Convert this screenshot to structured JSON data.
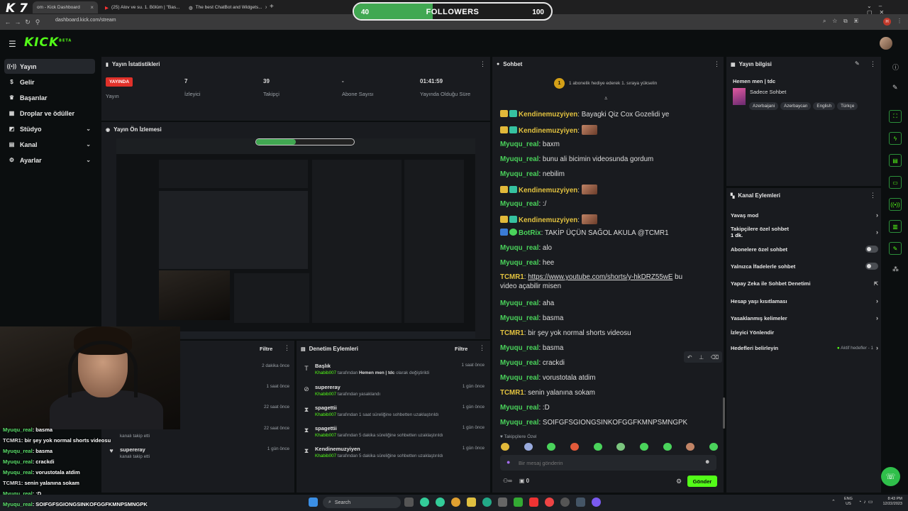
{
  "browser": {
    "tabs": [
      {
        "label": "om - Kick Dashboard",
        "active": true
      },
      {
        "label": "(25) Alov ve su. 1. Bölüm | \"Bas...",
        "active": false
      },
      {
        "label": "The best ChatBot and Widgets...",
        "active": false
      }
    ],
    "url": "dashboard.kick.com/stream",
    "overlay_logo": "K 7"
  },
  "followers_bar": {
    "left": "40",
    "label": "FOLLOWERS",
    "right": "100",
    "progress": 0.4
  },
  "header": {
    "logo": "KICK",
    "logo_sup": "BETA"
  },
  "sidebar": {
    "items": [
      {
        "label": "Yayın",
        "icon": "broadcast-icon"
      },
      {
        "label": "Gelir",
        "icon": "dollar-icon"
      },
      {
        "label": "Başarılar",
        "icon": "trophy-icon"
      },
      {
        "label": "Droplar ve ödüller",
        "icon": "gift-icon"
      },
      {
        "label": "Stüdyo",
        "icon": "studio-icon"
      },
      {
        "label": "Kanal",
        "icon": "channel-icon"
      },
      {
        "label": "Ayarlar",
        "icon": "gear-icon"
      }
    ]
  },
  "stats": {
    "title": "Yayın İstatistikleri",
    "live_badge": "YAYINDA",
    "live_label": "Yayın",
    "items": [
      {
        "value": "7",
        "label": "İzleyici"
      },
      {
        "value": "39",
        "label": "Takipçi"
      },
      {
        "value": "-",
        "label": "Abone Sayısı"
      },
      {
        "value": "01:41:59",
        "label": "Yayında Olduğu Süre"
      }
    ]
  },
  "preview": {
    "title": "Yayın Ön İzlemesi"
  },
  "activity": {
    "filter_label": "Filtre",
    "rows": [
      {
        "title": "",
        "sub": "",
        "time": "2 dakika önce"
      },
      {
        "title": "",
        "sub": "",
        "time": "1 saat önce"
      },
      {
        "title": "",
        "sub": "",
        "time": "22 saat önce"
      },
      {
        "title": "",
        "sub": "kanalı takip etti",
        "time": "22 saat önce"
      },
      {
        "title": "supereray",
        "sub": "kanalı takip etti",
        "time": "1 gün önce"
      }
    ]
  },
  "moderation": {
    "title": "Denetim Eylemleri",
    "filter_label": "Filtre",
    "rows": [
      {
        "title": "Başlık",
        "actor": "Khabib007",
        "text": "tarafından",
        "bold": "Hemen men | tdc",
        "rest": "olarak değiştirildi",
        "time": "1 saat önce",
        "icon": "text-icon"
      },
      {
        "title": "supereray",
        "actor": "Khabib007",
        "text": "tarafından yasaklandı",
        "bold": "",
        "rest": "",
        "time": "1 gün önce",
        "icon": "ban-icon"
      },
      {
        "title": "spagettii",
        "actor": "Khabib007",
        "text": "tarafından 1 saat süreliğine sohbetten uzaklaştırıldı",
        "bold": "",
        "rest": "",
        "time": "1 gün önce",
        "icon": "hourglass-icon"
      },
      {
        "title": "spagettii",
        "actor": "Khabib007",
        "text": "tarafından 5 dakika süreliğine sohbetten uzaklaştırıldı",
        "bold": "",
        "rest": "",
        "time": "1 gün önce",
        "icon": "hourglass-icon"
      },
      {
        "title": "Kendinemuzyiyen",
        "actor": "Khabib007",
        "text": "tarafından 5 dakika süreliğine sohbetten uzaklaştırıldı",
        "bold": "",
        "rest": "",
        "time": "1 gün önce",
        "icon": "hourglass-icon"
      }
    ]
  },
  "chat": {
    "title": "Sohbet",
    "gift_badge": "1",
    "gift_text": "1 abonelik hediye ederek 1. sıraya yükselin",
    "messages": [
      {
        "user": "Kendinemuzyiyen",
        "color": "uy",
        "badges": [
          "bcrown",
          "bgift"
        ],
        "text": "Bayagki Qiz Cox Gozelidi ye",
        "emote": false
      },
      {
        "user": "Kendinemuzyiyen",
        "color": "uy",
        "badges": [
          "bcrown",
          "bgift"
        ],
        "text": "",
        "emote": true
      },
      {
        "user": "Myuqu_real",
        "color": "ug",
        "badges": [],
        "text": "baxm",
        "emote": false
      },
      {
        "user": "Myuqu_real",
        "color": "ug",
        "badges": [],
        "text": "bunu ali bicimin videosunda gordum",
        "emote": false
      },
      {
        "user": "Myuqu_real",
        "color": "ug",
        "badges": [],
        "text": "nebilim",
        "emote": false
      },
      {
        "user": "Kendinemuzyiyen",
        "color": "uy",
        "badges": [
          "bcrown",
          "bgift"
        ],
        "text": "",
        "emote": true
      },
      {
        "user": "Myuqu_real",
        "color": "ug",
        "badges": [],
        "text": ":/",
        "emote": false
      },
      {
        "user": "Kendinemuzyiyen",
        "color": "uy",
        "badges": [
          "bcrown",
          "bgift"
        ],
        "text": "",
        "emote": true
      },
      {
        "user": "BotRix",
        "color": "ug",
        "badges": [
          "bbot",
          "bver"
        ],
        "text": "TAKİP ÜÇÜN SAĞOL AKULA @TCMR1",
        "emote": false
      },
      {
        "user": "Myuqu_real",
        "color": "ug",
        "badges": [],
        "text": "alo",
        "emote": false
      },
      {
        "user": "Myuqu_real",
        "color": "ug",
        "badges": [],
        "text": "hee",
        "emote": false
      }
    ],
    "link_msg": {
      "user": "TCMR1",
      "link": "https://www.youtube.com/shorts/y-hkDRZ55wE",
      "after": "bu",
      "line2": "video açabilir misen"
    },
    "messages2": [
      {
        "user": "Myuqu_real",
        "color": "ug",
        "text": "aha"
      },
      {
        "user": "Myuqu_real",
        "color": "ug",
        "text": "basma"
      },
      {
        "user": "TCMR1",
        "color": "uy",
        "text": "bir şey yok normal shorts videosu"
      },
      {
        "user": "Myuqu_real",
        "color": "ug",
        "text": "basma"
      },
      {
        "user": "Myuqu_real",
        "color": "ug",
        "text": "crackdi"
      },
      {
        "user": "Myuqu_real",
        "color": "ug",
        "text": "vorustotala atdim"
      },
      {
        "user": "TCMR1",
        "color": "uy",
        "text": "senin yalanına sokam"
      },
      {
        "user": "Myuqu_real",
        "color": "ug",
        "text": ":D"
      },
      {
        "user": "Myuqu_real",
        "color": "ug",
        "text": "SOIFGFSGIONGSINKOFGGFKMNPSMNGPK"
      }
    ],
    "followers_only": "Takipçilere Özel",
    "input_placeholder": "Bir mesaj gönderin",
    "footer_count": "0",
    "send_label": "Gönder"
  },
  "stream_info": {
    "title": "Yayın bilgisi",
    "stream_title": "Hemen men | tdc",
    "category": "Sadece Sohbet",
    "tags": [
      "Azerbaijani",
      "Azerbaycan",
      "English",
      "Türkçe"
    ]
  },
  "channel_actions": {
    "title": "Kanal Eylemleri",
    "items": [
      {
        "label": "Yavaş mod",
        "control": "chevron"
      },
      {
        "label": "Takipçilere özel sohbet",
        "sub": "1 dk.",
        "control": "chevron"
      },
      {
        "label": "Abonelere özel sohbet",
        "control": "toggle"
      },
      {
        "label": "Yalnızca İfadelerle sohbet",
        "control": "toggle"
      },
      {
        "label": "Yapay Zeka ile Sohbet Denetimi",
        "control": "external"
      },
      {
        "label": "Hesap yaşı kısıtlaması",
        "control": "chevron"
      },
      {
        "label": "Yasaklanmış kelimeler",
        "control": "chevron"
      },
      {
        "label": "İzleyici Yönlendir",
        "control": "none"
      },
      {
        "label": "Hedefleri belirleyin",
        "extra": "Aktif hedefler - 1",
        "control": "chevron"
      }
    ]
  },
  "overlay_chat": [
    {
      "user": "Myuqu_real",
      "color": "u",
      "text": "basma"
    },
    {
      "user": "TCMR1",
      "color": "t",
      "text": "bir şey yok normal shorts videosu"
    },
    {
      "user": "Myuqu_real",
      "color": "u",
      "text": "basma"
    },
    {
      "user": "Myuqu_real",
      "color": "u",
      "text": "crackdi"
    },
    {
      "user": "Myuqu_real",
      "color": "u",
      "text": "vorustotala atdim"
    },
    {
      "user": "TCMR1",
      "color": "t",
      "text": "senin yalanına sokam"
    },
    {
      "user": "Myuqu_real",
      "color": "u",
      "text": ":D"
    },
    {
      "user": "Myuqu_real",
      "color": "u",
      "text": "SOIFGFSGIONGSINKOFGGFKMNPSMNGPK"
    }
  ],
  "taskbar": {
    "search_label": "Search",
    "lang": "ENG",
    "region": "US",
    "time": "8:43 PM",
    "date": "12/22/2023"
  },
  "colors": {
    "accent": "#53fc18",
    "live": "#e0312a",
    "panel": "#191b1f"
  }
}
